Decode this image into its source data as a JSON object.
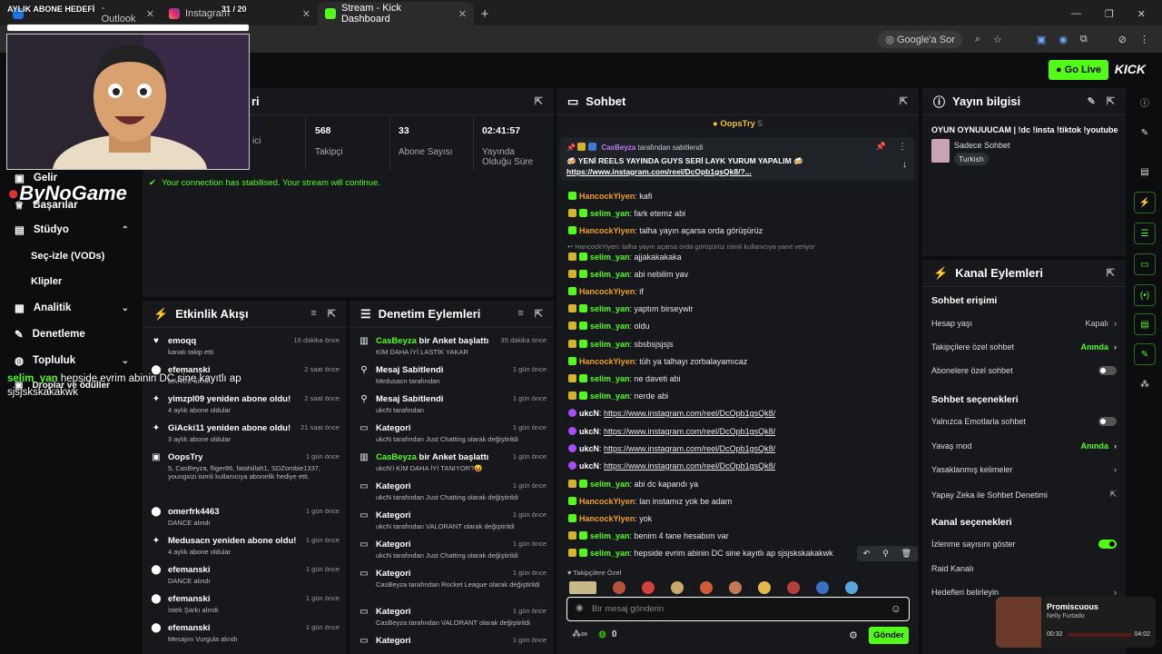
{
  "browser": {
    "tabs": [
      {
        "label": "- Outlook"
      },
      {
        "label": "Instagram"
      },
      {
        "label": "Stream - Kick Dashboard"
      }
    ],
    "new_tab": "+",
    "search_pill": "Google'a Sor"
  },
  "overlay": {
    "goal_label": "AYLIK ABONE HEDEFİ",
    "goal_count": "31 / 20",
    "brand": "ByNoGame",
    "chat_user": "selim_yan",
    "chat_message": "hepside evrim abinin DC sine kayıtlı ap sjsjskskakakwk"
  },
  "topbar": {
    "go_live": "Go Live",
    "logo": "KICK"
  },
  "nav": {
    "items": [
      {
        "label": "Gelir",
        "icon": "dollar-icon"
      },
      {
        "label": "Başarılar",
        "icon": "trophy-icon"
      },
      {
        "label": "Stüdyo",
        "icon": "studio-icon"
      },
      {
        "label": "Analitik",
        "icon": "chart-icon"
      },
      {
        "label": "Denetleme",
        "icon": "wrench-icon"
      },
      {
        "label": "Topluluk",
        "icon": "community-icon"
      },
      {
        "label": "Droplar ve ödüller",
        "icon": "gift-icon"
      }
    ],
    "studio_sub": [
      "Seç-izle (VODs)",
      "Klipler"
    ]
  },
  "stats": {
    "panel_title_suffix": "ri",
    "items": [
      {
        "value": "",
        "label": "ici"
      },
      {
        "value": "568",
        "label": "Takipçi"
      },
      {
        "value": "33",
        "label": "Abone Sayısı"
      },
      {
        "value": "02:41:57",
        "label": "Yayında Olduğu Süre"
      }
    ],
    "notice": "Your connection has stabilised. Your stream will continue."
  },
  "events": {
    "title": "Etkinlik Akışı",
    "items": [
      {
        "who": "emoqq",
        "sub": "kanalı takip etti",
        "time": "16 dakika önce",
        "icon": "heart-icon"
      },
      {
        "who": "efemanski",
        "sub": "DANCE alındı",
        "time": "2 saat önce",
        "icon": "gift-icon"
      },
      {
        "who": "yimzpl09 yeniden abone oldu!",
        "sub": "4 aylık abone oldular",
        "time": "2 saat önce",
        "icon": "star-icon"
      },
      {
        "who": "GiAcki11 yeniden abone oldu!",
        "sub": "3 aylık abone oldular",
        "time": "21 saat önce",
        "icon": "star-icon"
      },
      {
        "who": "OopsTry",
        "sub": "5, CasBeyza, fliger86, fatahillah1, SDZombie1337, youngxizi isimli kullanıcıya abonelik hediye etti.",
        "time": "1 gün önce",
        "icon": "gift-sub-icon"
      },
      {
        "who": "omerfrk4463",
        "sub": "DANCE alındı",
        "time": "1 gün önce",
        "icon": "gift-icon"
      },
      {
        "who": "Medusacn yeniden abone oldu!",
        "sub": "4 aylık abone oldular",
        "time": "1 gün önce",
        "icon": "star-icon"
      },
      {
        "who": "efemanski",
        "sub": "DANCE alındı",
        "time": "1 gün önce",
        "icon": "gift-icon"
      },
      {
        "who": "efemanski",
        "sub": "İstek Şarkı alındı",
        "time": "1 gün önce",
        "icon": "gift-icon"
      },
      {
        "who": "efemanski",
        "sub": "Mesajını Vurgula alındı",
        "time": "1 gün önce",
        "icon": "gift-icon"
      }
    ]
  },
  "moderation": {
    "title": "Denetim Eylemleri",
    "items": [
      {
        "who_g": "CasBeyza",
        "who": " bir Anket başlattı",
        "sub": "KİM DAHA İYİ LASTİK YAKAR",
        "time": "35 dakika önce",
        "icon": "poll-icon"
      },
      {
        "who_g": "",
        "who": "Mesaj Sabitlendi",
        "sub": "Medusacn tarafından",
        "time": "1 gün önce",
        "icon": "pin-icon"
      },
      {
        "who_g": "",
        "who": "Mesaj Sabitlendi",
        "sub": "ukcN tarafından",
        "time": "1 gün önce",
        "icon": "pin-icon"
      },
      {
        "who_g": "",
        "who": "Kategori",
        "sub": "ukcN tarafından Just Chatting olarak değiştirildi",
        "time": "1 gün önce",
        "icon": "category-icon"
      },
      {
        "who_g": "CasBeyza",
        "who": " bir Anket başlattı",
        "sub": "ukcN'i KİM DAHA İYİ TANIYOR?😝",
        "time": "1 gün önce",
        "icon": "poll-icon"
      },
      {
        "who_g": "",
        "who": "Kategori",
        "sub": "ukcN tarafından Just Chatting olarak değiştirildi",
        "time": "1 gün önce",
        "icon": "category-icon"
      },
      {
        "who_g": "",
        "who": "Kategori",
        "sub": "ukcN tarafından VALORANT olarak değiştirildi",
        "time": "1 gün önce",
        "icon": "category-icon"
      },
      {
        "who_g": "",
        "who": "Kategori",
        "sub": "ukcN tarafından Just Chatting olarak değiştirildi",
        "time": "1 gün önce",
        "icon": "category-icon"
      },
      {
        "who_g": "",
        "who": "Kategori",
        "sub": "CasBeyza tarafından Rocket League olarak değiştirildi",
        "time": "1 gün önce",
        "icon": "category-icon"
      },
      {
        "who_g": "",
        "who": "Kategori",
        "sub": "CasBeyza tarafından VALORANT olarak değiştirildi",
        "time": "1 gün önce",
        "icon": "category-icon"
      },
      {
        "who_g": "",
        "who": "Kategori",
        "sub": "",
        "time": "1 gün önce",
        "icon": "category-icon"
      }
    ]
  },
  "chat": {
    "title": "Sohbet",
    "top_gifter": "OopsTry",
    "top_gifter_count": "5",
    "pinned_by": "CasBeyza",
    "pinned_by_suffix": "tarafından sabitlendi",
    "pinned_text": "🍻 YENİ REELS YAYINDA GUYS SERİ LAYK YURUM YAPALIM 🍻",
    "pinned_link": "https://www.instagram.com/reel/DcOpb1gsQk8/?...",
    "reply_note": "HancockYiyen: talha yayın açarsa orda görüşürüz isimli kullanıcıya yanıt veriyor",
    "messages": [
      {
        "user": "HancockYiyen",
        "color": "orange",
        "text": "kafi"
      },
      {
        "user": "selim_yan",
        "color": "green",
        "text": "fark etemz abi"
      },
      {
        "user": "HancockYiyen",
        "color": "orange",
        "text": "talha yayın açarsa orda görüşürüz"
      },
      {
        "user": "selim_yan",
        "color": "green",
        "text": "ajjakakakaka"
      },
      {
        "user": "selim_yan",
        "color": "green",
        "text": "abi nebilim yav"
      },
      {
        "user": "HancockYiyen",
        "color": "orange",
        "text": "if"
      },
      {
        "user": "selim_yan",
        "color": "green",
        "text": "yaptım birseywlr"
      },
      {
        "user": "selim_yan",
        "color": "green",
        "text": "oldu"
      },
      {
        "user": "selim_yan",
        "color": "green",
        "text": "sbsbsjsjsjs"
      },
      {
        "user": "HancockYiyen",
        "color": "orange",
        "text": "tüh ya talhayı zorbalayamıcaz"
      },
      {
        "user": "selim_yan",
        "color": "green",
        "text": "ne daveti abi"
      },
      {
        "user": "selim_yan",
        "color": "green",
        "text": "nerde abi"
      },
      {
        "user": "ukcN",
        "color": "white",
        "text": "https://www.instagram.com/reel/DcOpb1gsQk8/",
        "link": true
      },
      {
        "user": "ukcN",
        "color": "white",
        "text": "https://www.instagram.com/reel/DcOpb1gsQk8/",
        "link": true
      },
      {
        "user": "ukcN",
        "color": "white",
        "text": "https://www.instagram.com/reel/DcOpb1gsQk8/",
        "link": true
      },
      {
        "user": "ukcN",
        "color": "white",
        "text": "https://www.instagram.com/reel/DcOpb1gsQk8/",
        "link": true
      },
      {
        "user": "selim_yan",
        "color": "green",
        "text": "abi dc kapandı ya"
      },
      {
        "user": "HancockYiyen",
        "color": "orange",
        "text": "lan instamız yok be adam"
      },
      {
        "user": "HancockYiyen",
        "color": "orange",
        "text": "yok"
      },
      {
        "user": "selim_yan",
        "color": "green",
        "text": "benim 4 tane hesabım var"
      },
      {
        "user": "selim_yan",
        "color": "green",
        "text": "hepside evrim abinin DC sine kayıtlı ap sjsjskskakakwk"
      }
    ],
    "followers_only": "Takipçilere Özel",
    "input_placeholder": "Bir mesaj gönderin",
    "send": "Gönder",
    "points": "0"
  },
  "stream_info": {
    "title": "Yayın bilgisi",
    "stream_title": "OYUN OYNUUUCAM | !dc !insta !tiktok !youtube",
    "category": "Sadece Sohbet",
    "language": "Turkish"
  },
  "channel_actions": {
    "title": "Kanal Eylemleri",
    "chat_access": "Sohbet erişimi",
    "rows1": [
      {
        "label": "Hesap yaşı",
        "value": "Kapalı",
        "kind": "chev"
      },
      {
        "label": "Takipçilere özel sohbet",
        "value": "Anında",
        "kind": "chevg"
      },
      {
        "label": "Abonelere özel sohbet",
        "value": "",
        "kind": "toggle"
      }
    ],
    "chat_options": "Sohbet seçenekleri",
    "rows2": [
      {
        "label": "Yalnızca Emotlarla sohbet",
        "value": "",
        "kind": "toggle"
      },
      {
        "label": "Yavaş mod",
        "value": "Anında",
        "kind": "chevg"
      },
      {
        "label": "Yasaklanmış kelimeler",
        "value": "",
        "kind": "chev"
      },
      {
        "label": "Yapay Zeka ile Sohbet Denetimi",
        "value": "",
        "kind": "ext"
      }
    ],
    "channel_options": "Kanal seçenekleri",
    "rows3": [
      {
        "label": "İzlenme sayısını göster",
        "value": "",
        "kind": "toggleon"
      },
      {
        "label": "Raid Kanalı",
        "value": "",
        "kind": "none"
      },
      {
        "label": "Hedefleri belirleyin",
        "value": "",
        "kind": "chev"
      }
    ]
  },
  "music": {
    "track": "Promiscuous",
    "artist": "Nelly Furtado",
    "elapsed": "00:32",
    "total": "04:02"
  },
  "colors": {
    "accent": "#53fc18",
    "panel": "#16181b",
    "bg": "#0b0d0f"
  }
}
